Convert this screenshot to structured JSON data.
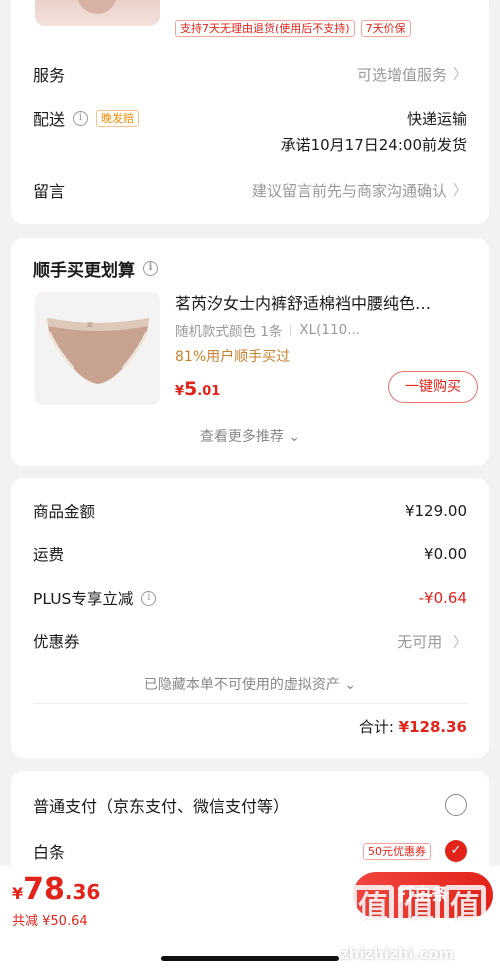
{
  "product_top": {
    "badges": [
      "支持7天无理由退货(使用后不支持)",
      "7天价保"
    ]
  },
  "order_info": {
    "service": {
      "label": "服务",
      "value": "可选增值服务"
    },
    "delivery": {
      "label": "配送",
      "tag": "晚发赔",
      "value": "快递运输",
      "promise": "承诺10月17日24:00前发货"
    },
    "message": {
      "label": "留言",
      "value": "建议留言前先与商家沟通确认"
    }
  },
  "addon": {
    "title": "顺手买更划算",
    "product": {
      "name": "茗芮汐女士内裤舒适棉裆中腰纯色…",
      "spec_color": "随机款式颜色 1条",
      "spec_size": "XL(110...",
      "stat": "81%用户顺手买过",
      "price_currency": "¥",
      "price_int": "5",
      "price_dec": ".01",
      "buy_label": "一键购买"
    },
    "more_label": "查看更多推荐"
  },
  "summary": {
    "goods": {
      "label": "商品金额",
      "value": "¥129.00"
    },
    "shipping": {
      "label": "运费",
      "value": "¥0.00"
    },
    "plus": {
      "label": "PLUS专享立减",
      "value": "-¥0.64"
    },
    "coupon": {
      "label": "优惠券",
      "value": "无可用"
    },
    "hidden_note": "已隐藏本单不可使用的虚拟资产",
    "total_label": "合计:",
    "total_value": "¥128.36"
  },
  "payment": {
    "option1": "普通支付（京东支付、微信支付等）",
    "option2": "白条",
    "option2_tag": "50元优惠券"
  },
  "bottom_bar": {
    "currency": "¥",
    "price_int": "78",
    "price_dec": ".36",
    "saved": "共减 ¥50.64",
    "pay_button": "打白条"
  },
  "watermark": {
    "logo_chars": [
      "值",
      "值",
      "值"
    ],
    "text": "zhizhizhi.com"
  },
  "colors": {
    "accent": "#e2231a",
    "orange": "#f08a00",
    "stat": "#c7812e"
  }
}
